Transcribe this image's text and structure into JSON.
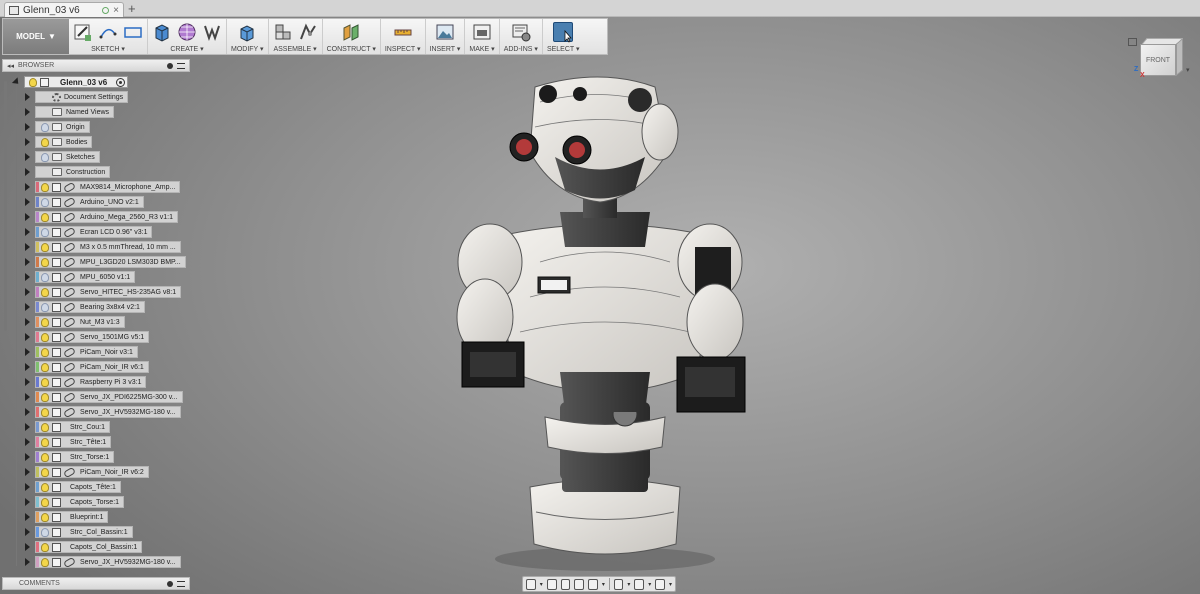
{
  "document": {
    "tab_title": "Glenn_03 v6",
    "new_tab": "+",
    "close": "×"
  },
  "toolbar": {
    "workspace": "MODEL",
    "workspace_caret": "▼",
    "groups": [
      {
        "label": "SKETCH ▾"
      },
      {
        "label": "CREATE ▾"
      },
      {
        "label": "MODIFY ▾"
      },
      {
        "label": "ASSEMBLE ▾"
      },
      {
        "label": "CONSTRUCT ▾"
      },
      {
        "label": "INSPECT ▾"
      },
      {
        "label": "INSERT ▾"
      },
      {
        "label": "MAKE ▾"
      },
      {
        "label": "ADD-INS ▾"
      },
      {
        "label": "SELECT ▾"
      }
    ]
  },
  "browser": {
    "title": "BROWSER",
    "collapse": "◂◂",
    "root": "Glenn_03 v6",
    "items": [
      {
        "label": "Document Settings",
        "icon": "gear-icon",
        "bulb": "none",
        "color": ""
      },
      {
        "label": "Named Views",
        "icon": "folder-icon",
        "bulb": "none",
        "color": ""
      },
      {
        "label": "Origin",
        "icon": "folder-icon",
        "bulb": "dim",
        "color": ""
      },
      {
        "label": "Bodies",
        "icon": "folder-icon",
        "bulb": "on",
        "color": ""
      },
      {
        "label": "Sketches",
        "icon": "folder-icon",
        "bulb": "dim",
        "color": ""
      },
      {
        "label": "Construction",
        "icon": "folder-icon",
        "bulb": "none",
        "color": ""
      },
      {
        "label": "MAX9814_Microphone_Amp...",
        "icon": "link-icon",
        "bulb": "on",
        "color": "#d96a7a"
      },
      {
        "label": "Arduino_UNO v2:1",
        "icon": "link-icon",
        "bulb": "dim",
        "color": "#6f84c9"
      },
      {
        "label": "Arduino_Mega_2560_R3 v1:1",
        "icon": "link-icon",
        "bulb": "on",
        "color": "#b886c9"
      },
      {
        "label": "Ecran LCD 0.96\" v3:1",
        "icon": "link-icon",
        "bulb": "dim",
        "color": "#6f9fd0"
      },
      {
        "label": "M3 x 0.5 mmThread, 10 mm ...",
        "icon": "link-icon",
        "bulb": "on",
        "color": "#d0c060"
      },
      {
        "label": "MPU_L3GD20 LSM303D BMP...",
        "icon": "link-icon",
        "bulb": "on",
        "color": "#d07a4a"
      },
      {
        "label": "MPU_6050 v1:1",
        "icon": "link-icon",
        "bulb": "dim",
        "color": "#6fb0d0"
      },
      {
        "label": "Servo_HITEC_HS-235AG v8:1",
        "icon": "link-icon",
        "bulb": "on",
        "color": "#c080c0"
      },
      {
        "label": "Bearing 3x8x4 v2:1",
        "icon": "link-icon",
        "bulb": "dim",
        "color": "#7a8ad0"
      },
      {
        "label": "Nut_M3 v1:3",
        "icon": "link-icon",
        "bulb": "on",
        "color": "#e09060"
      },
      {
        "label": "Servo_1501MG v5:1",
        "icon": "link-icon",
        "bulb": "on",
        "color": "#e07a90"
      },
      {
        "label": "PiCam_Noir v3:1",
        "icon": "link-icon",
        "bulb": "on",
        "color": "#a0c060"
      },
      {
        "label": "PiCam_Noir_IR v6:1",
        "icon": "link-icon",
        "bulb": "on",
        "color": "#80c070"
      },
      {
        "label": "Raspberry Pi 3 v3:1",
        "icon": "link-icon",
        "bulb": "on",
        "color": "#6a7ad0"
      },
      {
        "label": "Servo_JX_PDI6225MG-300 v...",
        "icon": "link-icon",
        "bulb": "on",
        "color": "#e08a50"
      },
      {
        "label": "Servo_JX_HV5932MG-180 v...",
        "icon": "link-icon",
        "bulb": "on",
        "color": "#e07070"
      },
      {
        "label": "Strc_Cou:1",
        "icon": "box-icon",
        "bulb": "on",
        "color": "#7a9ad0"
      },
      {
        "label": "Strc_Tête:1",
        "icon": "box-icon",
        "bulb": "on",
        "color": "#e080a0"
      },
      {
        "label": "Strc_Torse:1",
        "icon": "box-icon",
        "bulb": "on",
        "color": "#a080d0"
      },
      {
        "label": "PiCam_Noir_IR v6:2",
        "icon": "link-icon",
        "bulb": "on",
        "color": "#c0c060"
      },
      {
        "label": "Capots_Tête:1",
        "icon": "box-icon",
        "bulb": "on",
        "color": "#70a0d0"
      },
      {
        "label": "Capots_Torse:1",
        "icon": "box-icon",
        "bulb": "on",
        "color": "#80c0d0"
      },
      {
        "label": "Blueprint:1",
        "icon": "box-icon",
        "bulb": "on",
        "color": "#e0a060"
      },
      {
        "label": "Strc_Col_Bassin:1",
        "icon": "box-icon",
        "bulb": "dim",
        "color": "#6a9ae0"
      },
      {
        "label": "Capots_Col_Bassin:1",
        "icon": "box-icon",
        "bulb": "on",
        "color": "#e07080"
      },
      {
        "label": "Servo_JX_HV5932MG-180 v...",
        "icon": "link-icon",
        "bulb": "on",
        "color": "#d0a0c0"
      }
    ]
  },
  "comments": {
    "title": "COMMENTS"
  },
  "viewcube": {
    "face": "FRONT",
    "axis_z": "Z",
    "axis_x": "X"
  }
}
